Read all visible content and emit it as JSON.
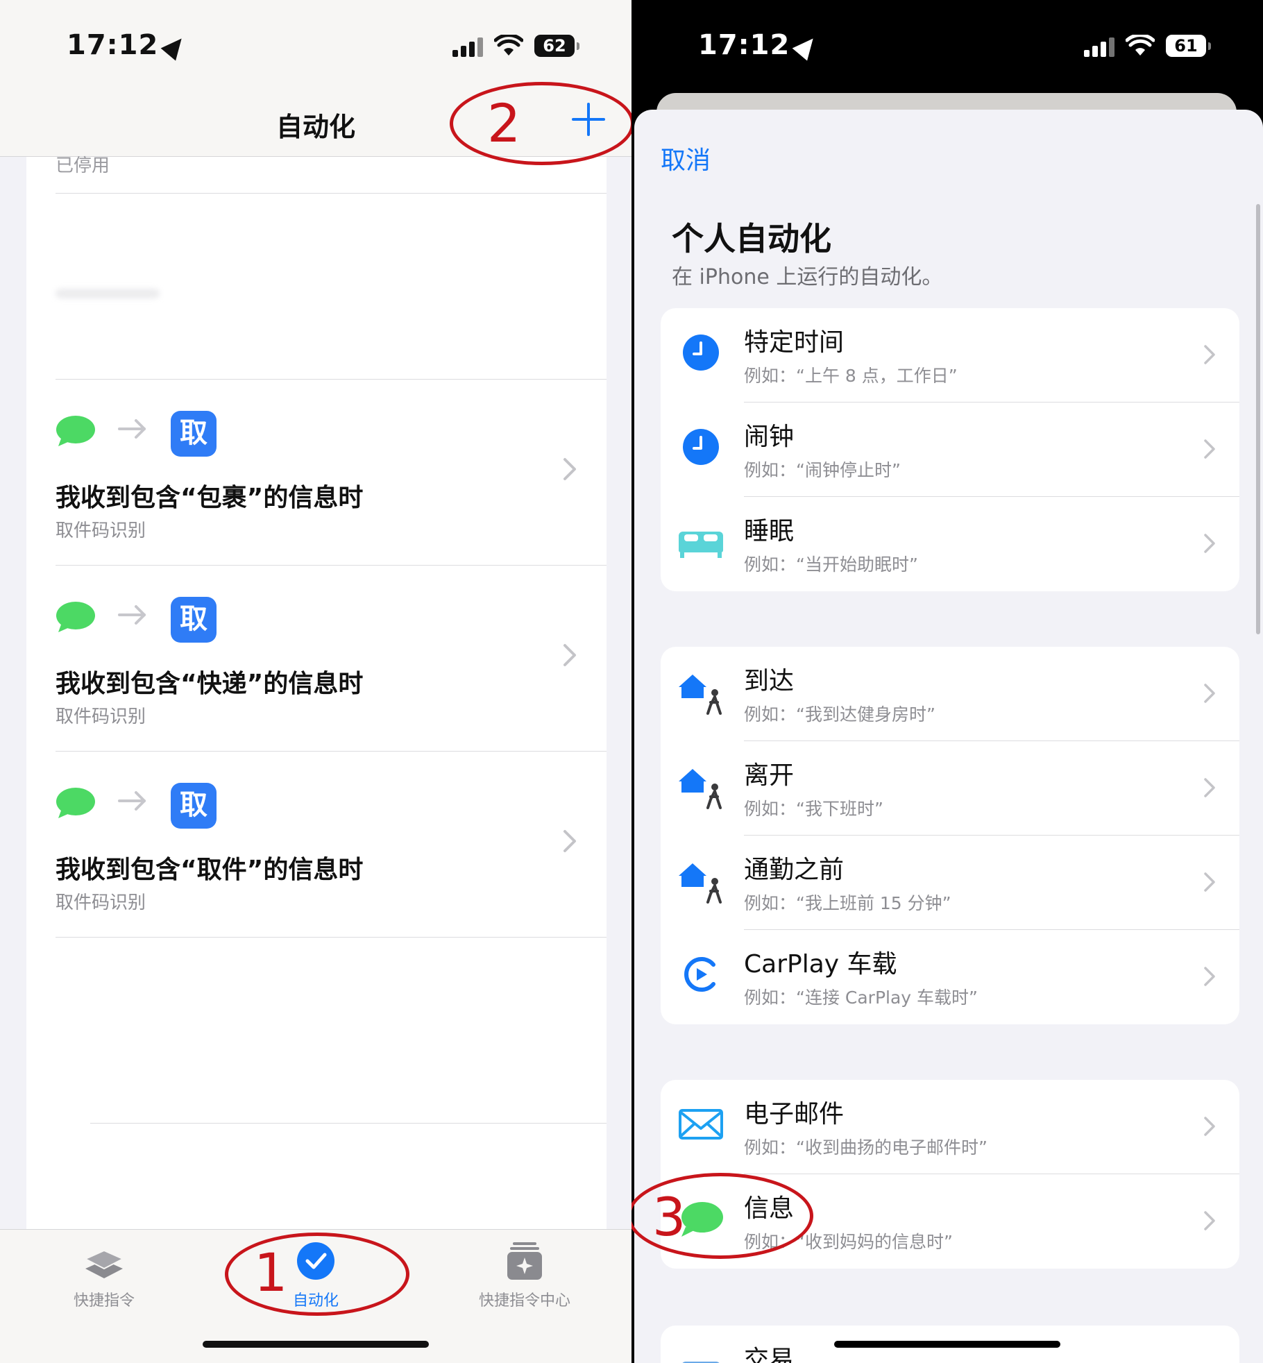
{
  "left": {
    "status": {
      "time": "17:12",
      "battery": "62"
    },
    "nav": {
      "title": "自动化"
    },
    "stub_text": "已停用",
    "automations": [
      {
        "title": "我收到包含“包裹”的信息时",
        "subtitle": "取件码识别",
        "app_icon_char": "取"
      },
      {
        "title": "我收到包含“快递”的信息时",
        "subtitle": "取件码识别",
        "app_icon_char": "取"
      },
      {
        "title": "我收到包含“取件”的信息时",
        "subtitle": "取件码识别",
        "app_icon_char": "取"
      }
    ],
    "tabs": [
      {
        "label": "快捷指令",
        "icon": "layers-icon",
        "selected": false
      },
      {
        "label": "自动化",
        "icon": "checkmark-circle-icon",
        "selected": true
      },
      {
        "label": "快捷指令中心",
        "icon": "gallery-icon",
        "selected": false
      }
    ]
  },
  "right": {
    "status": {
      "time": "17:12",
      "battery": "61"
    },
    "cancel_label": "取消",
    "header": {
      "title": "个人自动化",
      "subtitle": "在 iPhone 上运行的自动化。"
    },
    "groups": [
      {
        "items": [
          {
            "title": "特定时间",
            "subtitle": "例如：“上午 8 点，工作日”",
            "icon": "clock-icon"
          },
          {
            "title": "闹钟",
            "subtitle": "例如：“闹钟停止时”",
            "icon": "clock-icon"
          },
          {
            "title": "睡眠",
            "subtitle": "例如：“当开始助眠时”",
            "icon": "bed-icon"
          }
        ]
      },
      {
        "items": [
          {
            "title": "到达",
            "subtitle": "例如：“我到达健身房时”",
            "icon": "home-arrive-icon"
          },
          {
            "title": "离开",
            "subtitle": "例如：“我下班时”",
            "icon": "home-leave-icon"
          },
          {
            "title": "通勤之前",
            "subtitle": "例如：“我上班前 15 分钟”",
            "icon": "home-commute-icon"
          },
          {
            "title": "CarPlay 车载",
            "subtitle": "例如：“连接 CarPlay 车载时”",
            "icon": "carplay-icon"
          }
        ]
      },
      {
        "items": [
          {
            "title": "电子邮件",
            "subtitle": "例如：“收到曲扬的电子邮件时”",
            "icon": "mail-icon"
          },
          {
            "title": "信息",
            "subtitle": "例如：“收到妈妈的信息时”",
            "icon": "message-icon"
          }
        ]
      },
      {
        "items": [
          {
            "title": "交易",
            "subtitle": "",
            "icon": "wallet-icon"
          }
        ]
      }
    ]
  },
  "annotations": [
    {
      "number": "1",
      "target": "自动化 tab"
    },
    {
      "number": "2",
      "target": "add button"
    },
    {
      "number": "3",
      "target": "信息 row"
    }
  ],
  "colors": {
    "accent_blue": "#1477f8",
    "message_green": "#4cd964",
    "annotation_red": "#c8151b",
    "app_icon_blue": "#2f7cf6"
  }
}
